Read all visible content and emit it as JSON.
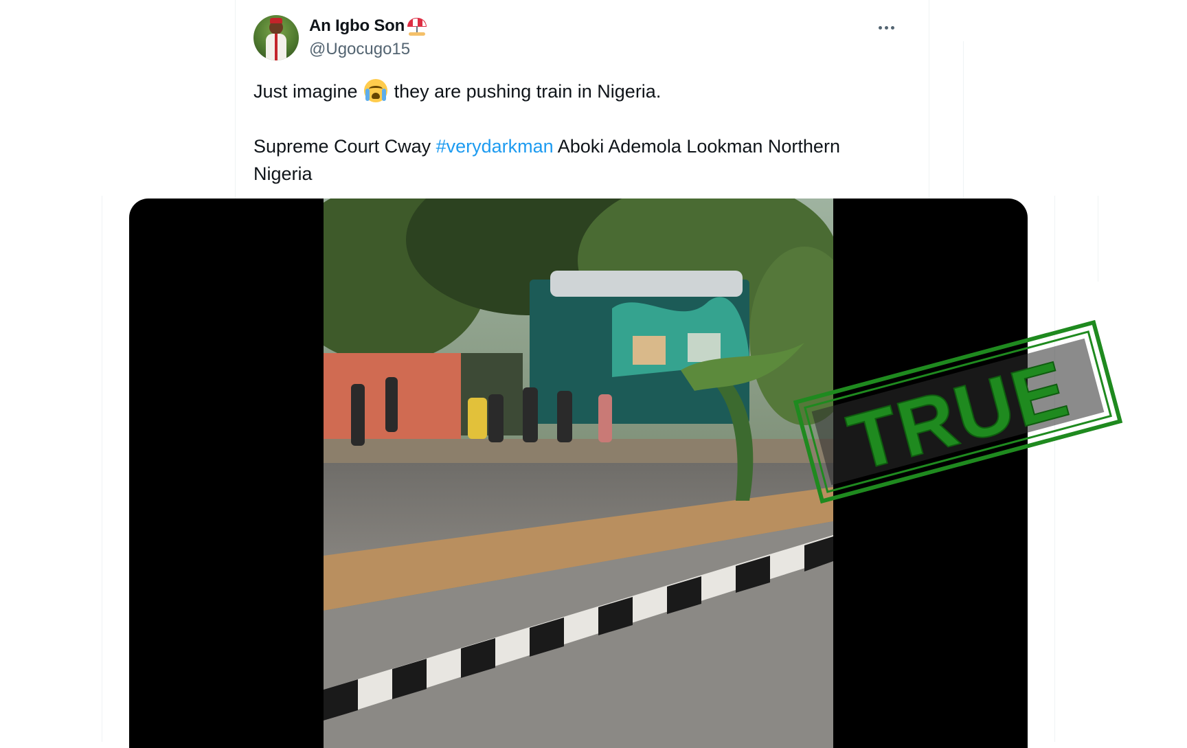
{
  "tweet": {
    "author_name": "An Igbo Son",
    "author_name_emoji": "beach-umbrella-icon",
    "handle": "@Ugocugo15",
    "text_line1_before": "Just imagine",
    "text_line1_emoji": "loudly-crying-face-icon",
    "text_line1_after": "they are pushing train in Nigeria.",
    "text_line2_before": "Supreme Court Cway",
    "hashtag": "#verydarkman",
    "text_line2_after": "Aboki Ademola Lookman Northern Nigeria",
    "more_icon": "more-options-icon"
  },
  "media": {
    "type": "video",
    "description_icon": "video-frame"
  },
  "verdict": {
    "label": "TRUE",
    "color": "#1f8a1f"
  },
  "colors": {
    "link": "#1d9bf0",
    "secondary_text": "#536471",
    "text": "#0f1419"
  }
}
